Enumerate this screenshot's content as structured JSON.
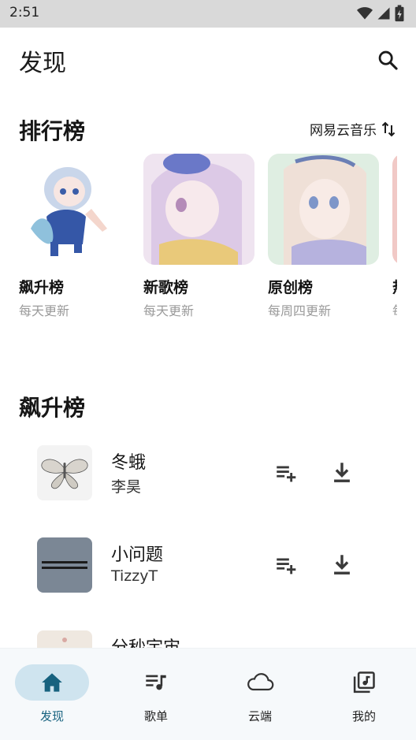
{
  "status": {
    "time": "2:51"
  },
  "appbar": {
    "title": "发现",
    "search_icon": "search-icon"
  },
  "ranking": {
    "heading": "排行榜",
    "source_label": "网易云音乐",
    "source_icon": "swap-vert-icon",
    "charts": [
      {
        "name": "飙升榜",
        "subtitle": "每天更新"
      },
      {
        "name": "新歌榜",
        "subtitle": "每天更新"
      },
      {
        "name": "原创榜",
        "subtitle": "每周四更新"
      },
      {
        "name": "热",
        "subtitle": "每"
      }
    ]
  },
  "songs": {
    "heading": "飙升榜",
    "items": [
      {
        "title": "冬蛾",
        "artist": "李昊"
      },
      {
        "title": "小问题",
        "artist": "TizzyT"
      },
      {
        "title": "分秒宇宙",
        "artist": ""
      }
    ]
  },
  "nav": {
    "items": [
      {
        "label": "发现",
        "icon": "home-icon",
        "active": true
      },
      {
        "label": "歌单",
        "icon": "queue-music-icon",
        "active": false
      },
      {
        "label": "云端",
        "icon": "cloud-icon",
        "active": false
      },
      {
        "label": "我的",
        "icon": "library-music-icon",
        "active": false
      }
    ]
  },
  "colors": {
    "accent": "#17627f",
    "nav_pill": "#cfe4ef",
    "statusbar": "#d9d9d9"
  }
}
